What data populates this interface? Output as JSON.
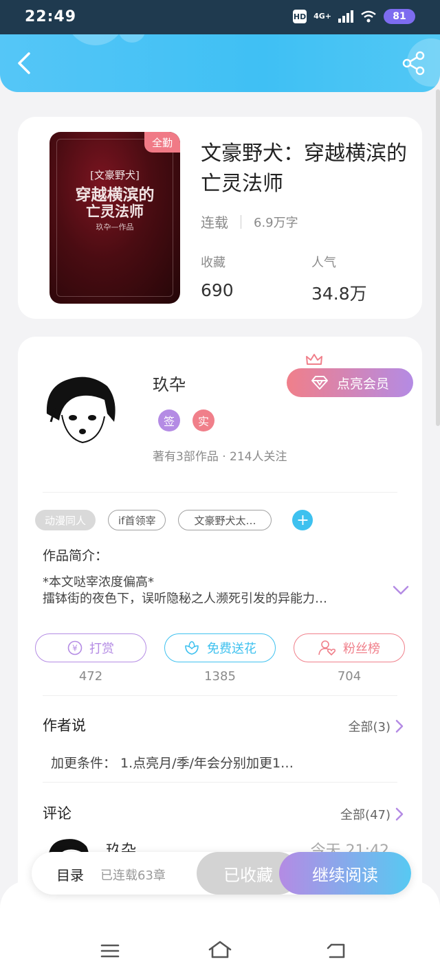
{
  "status_bar": {
    "time": "22:49",
    "hd": "HD",
    "network": "4G+",
    "battery": "81"
  },
  "header": {
    "back_icon": "chevron-left-icon",
    "share_icon": "share-icon"
  },
  "book": {
    "badge": "全勤",
    "title": "文豪野犬：穿越横滨的亡灵法师",
    "status": "连载",
    "word_count": "6.9万字",
    "favorites_label": "收藏",
    "favorites_value": "690",
    "popularity_label": "人气",
    "popularity_value": "34.8万",
    "cover": {
      "line1": "[文豪野犬]",
      "line2": "穿越横滨的",
      "line3": "亡灵法师",
      "author": "玖卆—作品"
    }
  },
  "author": {
    "name": "玖卆",
    "vip_button": "点亮会员",
    "badge_sign": "签",
    "badge_real": "实",
    "stats": "著有3部作品 · 214人关注"
  },
  "tags": [
    "动漫同人",
    "if首领宰",
    "文豪野犬太…"
  ],
  "intro": {
    "label": "作品简介：",
    "line1": "*本文哒宰浓度偏高*",
    "line2": "擂钵街的夜色下，误听隐秘之人濒死引发的异能力…"
  },
  "actions": [
    {
      "label": "打赏",
      "count": "472",
      "icon": "yen-icon",
      "color": "#b48be4"
    },
    {
      "label": "免费送花",
      "count": "1385",
      "icon": "flower-icon",
      "color": "#3ec1ef"
    },
    {
      "label": "粉丝榜",
      "count": "704",
      "icon": "fan-icon",
      "color": "#f07f8a"
    }
  ],
  "author_says": {
    "title": "作者说",
    "more": "全部(3)",
    "content": "加更条件：  1.点亮月/季/年会分别加更1…"
  },
  "comments": {
    "title": "评论",
    "more": "全部(47)",
    "first_name": "玖卆",
    "first_time": "今天  21:42"
  },
  "bottom_bar": {
    "toc": "目录",
    "chapters": "已连载63章",
    "saved": "已收藏",
    "continue": "继续阅读"
  },
  "nav": {
    "menu_icon": "menu-icon",
    "home_icon": "home-icon",
    "back_icon": "back-icon"
  }
}
